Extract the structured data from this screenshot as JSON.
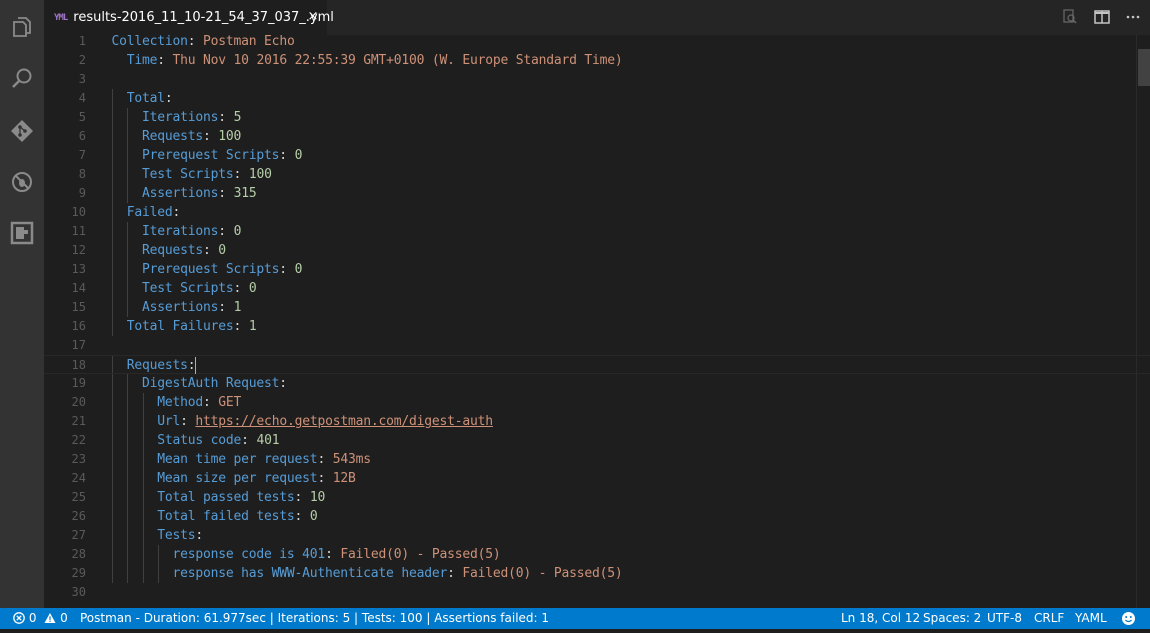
{
  "tab": {
    "filename": "results-2016_11_10-21_54_37_037_.yml",
    "icon_text": "YML",
    "close": "×"
  },
  "activity_bar": [
    "files-icon",
    "search-icon",
    "git-icon",
    "debug-icon",
    "extensions-icon"
  ],
  "editor_actions": [
    "open-preview-icon",
    "split-editor-icon",
    "more-actions-icon"
  ],
  "editor": {
    "line_numbers": [
      "1",
      "2",
      "3",
      "4",
      "5",
      "6",
      "7",
      "8",
      "9",
      "10",
      "11",
      "12",
      "13",
      "14",
      "15",
      "16",
      "17",
      "18",
      "19",
      "20",
      "21",
      "22",
      "23",
      "24",
      "25",
      "26",
      "27",
      "28",
      "29",
      "30"
    ],
    "lines": [
      {
        "indent": "",
        "key": "Collection",
        "sep": ": ",
        "value": "Postman Echo",
        "vclass": "s"
      },
      {
        "indent": "  ",
        "key": "Time",
        "sep": ": ",
        "value": "Thu Nov 10 2016 22:55:39 GMT+0100 (W. Europe Standard Time)",
        "vclass": "s"
      },
      {
        "indent": "",
        "key": "",
        "sep": "",
        "value": "",
        "vclass": "s"
      },
      {
        "indent": "  ",
        "key": "Total",
        "sep": ":",
        "value": "",
        "vclass": "s"
      },
      {
        "indent": "    ",
        "key": "Iterations",
        "sep": ": ",
        "value": "5",
        "vclass": "n"
      },
      {
        "indent": "    ",
        "key": "Requests",
        "sep": ": ",
        "value": "100",
        "vclass": "n"
      },
      {
        "indent": "    ",
        "key": "Prerequest Scripts",
        "sep": ": ",
        "value": "0",
        "vclass": "n"
      },
      {
        "indent": "    ",
        "key": "Test Scripts",
        "sep": ": ",
        "value": "100",
        "vclass": "n"
      },
      {
        "indent": "    ",
        "key": "Assertions",
        "sep": ": ",
        "value": "315",
        "vclass": "n"
      },
      {
        "indent": "  ",
        "key": "Failed",
        "sep": ":",
        "value": "",
        "vclass": "s"
      },
      {
        "indent": "    ",
        "key": "Iterations",
        "sep": ": ",
        "value": "0",
        "vclass": "n"
      },
      {
        "indent": "    ",
        "key": "Requests",
        "sep": ": ",
        "value": "0",
        "vclass": "n"
      },
      {
        "indent": "    ",
        "key": "Prerequest Scripts",
        "sep": ": ",
        "value": "0",
        "vclass": "n"
      },
      {
        "indent": "    ",
        "key": "Test Scripts",
        "sep": ": ",
        "value": "0",
        "vclass": "n"
      },
      {
        "indent": "    ",
        "key": "Assertions",
        "sep": ": ",
        "value": "1",
        "vclass": "n"
      },
      {
        "indent": "  ",
        "key": "Total Failures",
        "sep": ": ",
        "value": "1",
        "vclass": "n"
      },
      {
        "indent": "",
        "key": "",
        "sep": "",
        "value": "",
        "vclass": "s"
      },
      {
        "indent": "  ",
        "key": "Requests",
        "sep": ":",
        "value": "",
        "vclass": "s",
        "cursor": true
      },
      {
        "indent": "    ",
        "key": "DigestAuth Request",
        "sep": ":",
        "value": "",
        "vclass": "s"
      },
      {
        "indent": "      ",
        "key": "Method",
        "sep": ": ",
        "value": "GET",
        "vclass": "s"
      },
      {
        "indent": "      ",
        "key": "Url",
        "sep": ": ",
        "value": "https://echo.getpostman.com/digest-auth",
        "vclass": "u"
      },
      {
        "indent": "      ",
        "key": "Status code",
        "sep": ": ",
        "value": "401",
        "vclass": "n"
      },
      {
        "indent": "      ",
        "key": "Mean time per request",
        "sep": ": ",
        "value": "543ms",
        "vclass": "s"
      },
      {
        "indent": "      ",
        "key": "Mean size per request",
        "sep": ": ",
        "value": "12B",
        "vclass": "s"
      },
      {
        "indent": "      ",
        "key": "Total passed tests",
        "sep": ": ",
        "value": "10",
        "vclass": "n"
      },
      {
        "indent": "      ",
        "key": "Total failed tests",
        "sep": ": ",
        "value": "0",
        "vclass": "n"
      },
      {
        "indent": "      ",
        "key": "Tests",
        "sep": ":",
        "value": "",
        "vclass": "s"
      },
      {
        "indent": "        ",
        "key": "response code is 401",
        "sep": ": ",
        "value": "Failed(0) - Passed(5)",
        "vclass": "s"
      },
      {
        "indent": "        ",
        "key": "response has WWW-Authenticate header",
        "sep": ": ",
        "value": "Failed(0) - Passed(5)",
        "vclass": "s"
      },
      {
        "indent": "",
        "key": "",
        "sep": "",
        "value": "",
        "vclass": "s"
      }
    ]
  },
  "statusbar": {
    "errors": "0",
    "warnings": "0",
    "message": "Postman - Duration: 61.977sec | Iterations: 5 | Tests: 100 | Assertions failed: 1",
    "position": "Ln 18, Col 12",
    "indentation": "Spaces: 2",
    "encoding": "UTF-8",
    "eol": "CRLF",
    "language": "YAML"
  }
}
